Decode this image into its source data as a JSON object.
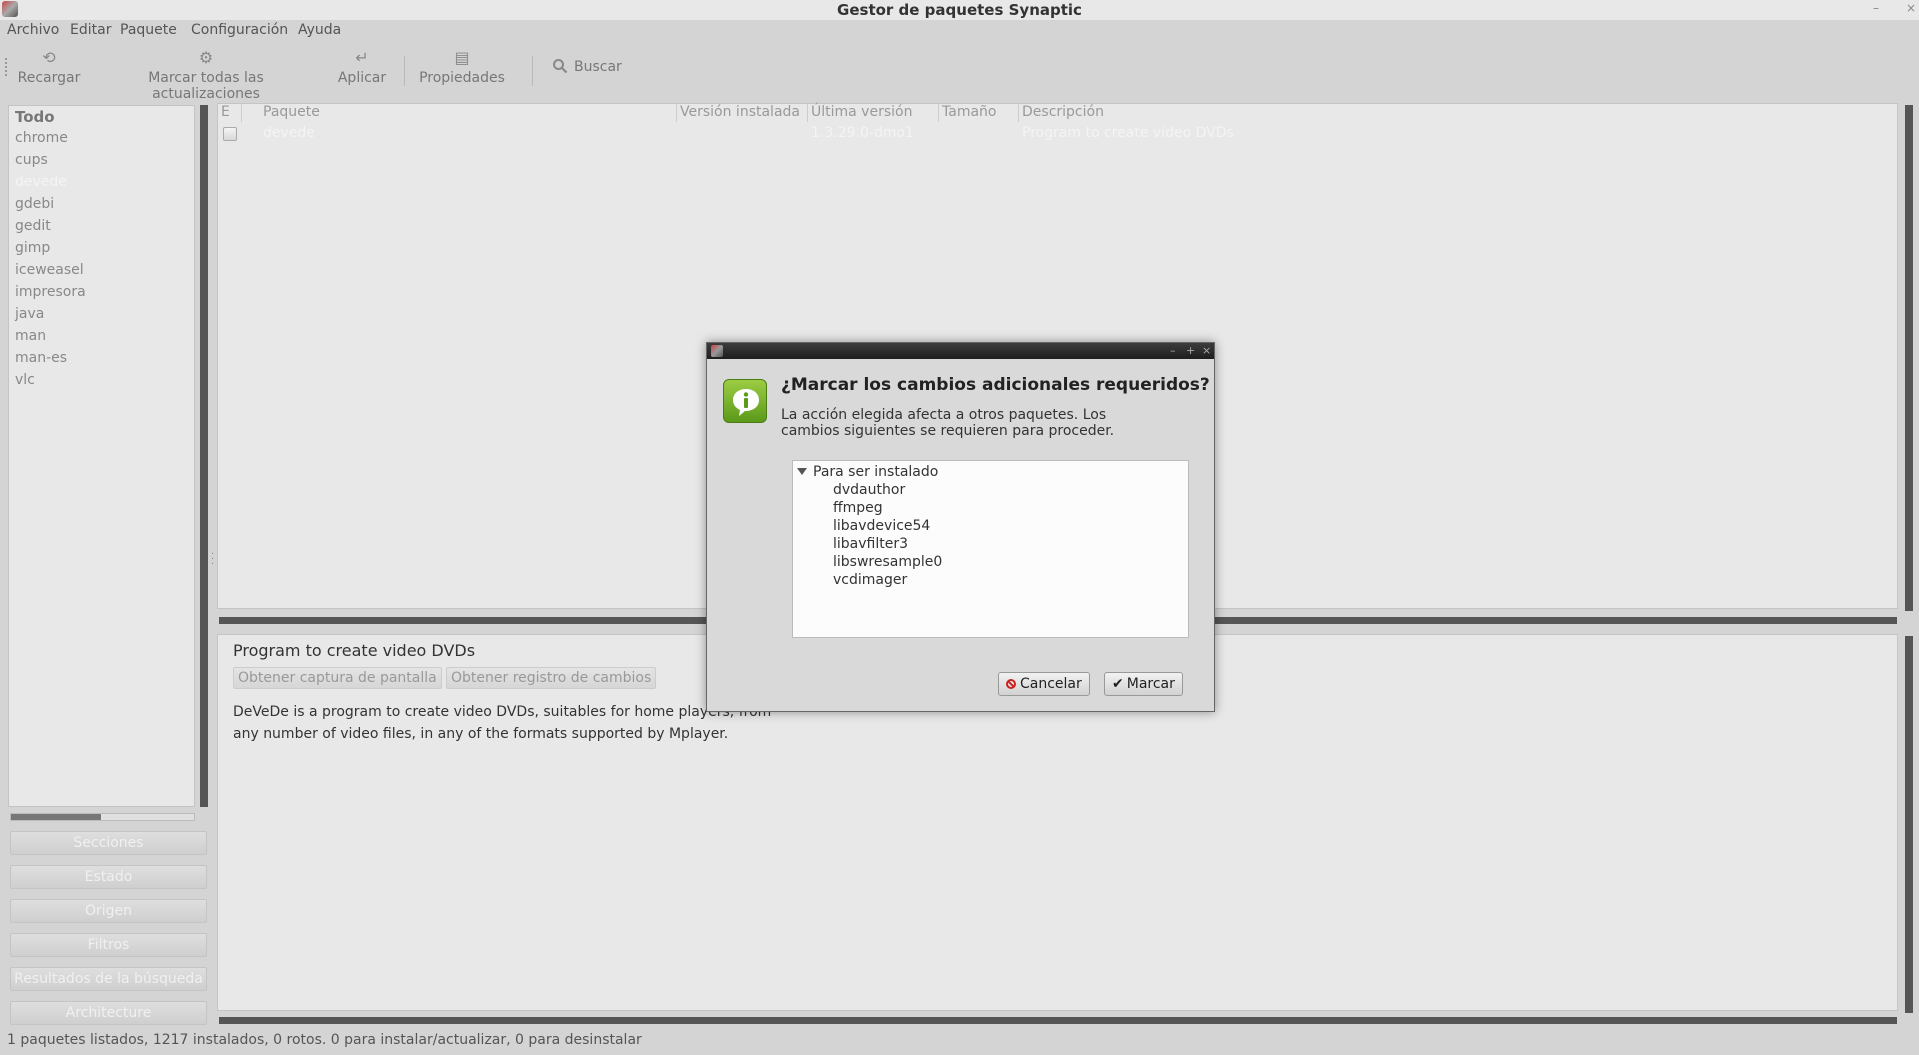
{
  "window": {
    "title": "Gestor de paquetes Synaptic",
    "minimize": "–",
    "close": "×"
  },
  "menu": [
    "Archivo",
    "Editar",
    "Paquete",
    "Configuración",
    "Ayuda"
  ],
  "toolbar": {
    "reload": "Recargar",
    "mark_all": "Marcar todas las actualizaciones",
    "apply": "Aplicar",
    "properties": "Propiedades",
    "search": "Buscar"
  },
  "filters": {
    "items": [
      "Todo",
      "chrome",
      "cups",
      "devede",
      "gdebi",
      "gedit",
      "gimp",
      "iceweasel",
      "impresora",
      "java",
      "man",
      "man-es",
      "vlc"
    ],
    "selected": "devede",
    "scroll_fraction": 0.48,
    "buttons": [
      "Secciones",
      "Estado",
      "Origen",
      "Filtros",
      "Resultados de la búsqueda",
      "Architecture"
    ]
  },
  "package_list": {
    "columns": [
      "E",
      "Paquete",
      "Versión instalada",
      "Última versión",
      "Tamaño",
      "Descripción"
    ],
    "rows": [
      {
        "name": "devede",
        "installed_version": "",
        "latest_version": "1.3.29.0-dmo1",
        "size": "",
        "description": "Program to create video DVDs"
      }
    ]
  },
  "details": {
    "title": "Program to create video DVDs",
    "screenshot_button": "Obtener captura de pantalla",
    "changelog_button": "Obtener registro de cambios",
    "description": "DeVeDe is a program to create video DVDs, suitables for home players, from any number of video files, in any of the formats supported by Mplayer."
  },
  "status": "1 paquetes listados, 1217 instalados, 0 rotos. 0 para instalar/actualizar, 0 para desinstalar",
  "dialog": {
    "heading": "¿Marcar los cambios adicionales requeridos?",
    "message": "La acción elegida afecta a otros paquetes. Los cambios siguientes se requieren para proceder.",
    "tree_parent": "Para ser instalado",
    "tree_children": [
      "dvdauthor",
      "ffmpeg",
      "libavdevice54",
      "libavfilter3",
      "libswresample0",
      "vcdimager"
    ],
    "cancel": "Cancelar",
    "mark": "Marcar"
  }
}
